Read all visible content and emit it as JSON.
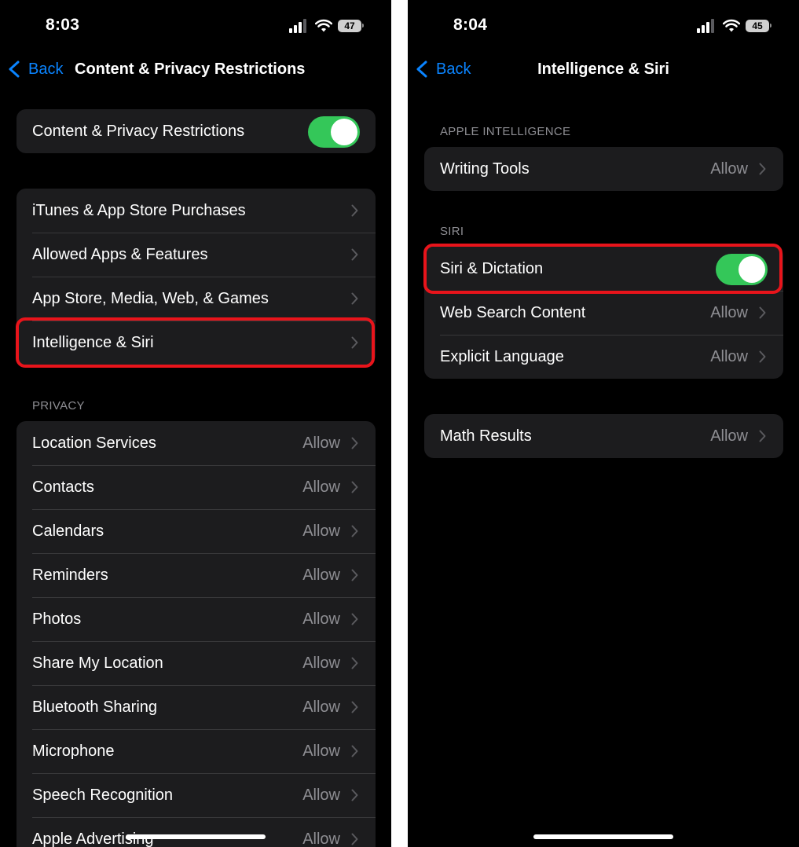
{
  "left": {
    "status": {
      "time": "8:03",
      "battery": "47"
    },
    "nav": {
      "back_label": "Back",
      "title": "Content & Privacy Restrictions"
    },
    "master_toggle": {
      "label": "Content & Privacy Restrictions",
      "on": true
    },
    "main_items": [
      {
        "label": "iTunes & App Store Purchases"
      },
      {
        "label": "Allowed Apps & Features"
      },
      {
        "label": "App Store, Media, Web, & Games"
      },
      {
        "label": "Intelligence & Siri"
      }
    ],
    "privacy_header": "PRIVACY",
    "privacy_items": [
      {
        "label": "Location Services",
        "value": "Allow"
      },
      {
        "label": "Contacts",
        "value": "Allow"
      },
      {
        "label": "Calendars",
        "value": "Allow"
      },
      {
        "label": "Reminders",
        "value": "Allow"
      },
      {
        "label": "Photos",
        "value": "Allow"
      },
      {
        "label": "Share My Location",
        "value": "Allow"
      },
      {
        "label": "Bluetooth Sharing",
        "value": "Allow"
      },
      {
        "label": "Microphone",
        "value": "Allow"
      },
      {
        "label": "Speech Recognition",
        "value": "Allow"
      },
      {
        "label": "Apple Advertising",
        "value": "Allow"
      }
    ]
  },
  "right": {
    "status": {
      "time": "8:04",
      "battery": "45"
    },
    "nav": {
      "back_label": "Back",
      "title": "Intelligence & Siri"
    },
    "apple_intelligence_header": "APPLE INTELLIGENCE",
    "writing_tools": {
      "label": "Writing Tools",
      "value": "Allow"
    },
    "siri_header": "SIRI",
    "siri_dictation": {
      "label": "Siri & Dictation",
      "on": true
    },
    "web_search": {
      "label": "Web Search Content",
      "value": "Allow"
    },
    "explicit_language": {
      "label": "Explicit Language",
      "value": "Allow"
    },
    "math_results": {
      "label": "Math Results",
      "value": "Allow"
    }
  },
  "colors": {
    "accent": "#0a84ff",
    "toggle_on": "#34c759",
    "highlight": "#e8141b",
    "cell_bg": "#1c1c1e",
    "secondary_text": "#8e8e93"
  }
}
